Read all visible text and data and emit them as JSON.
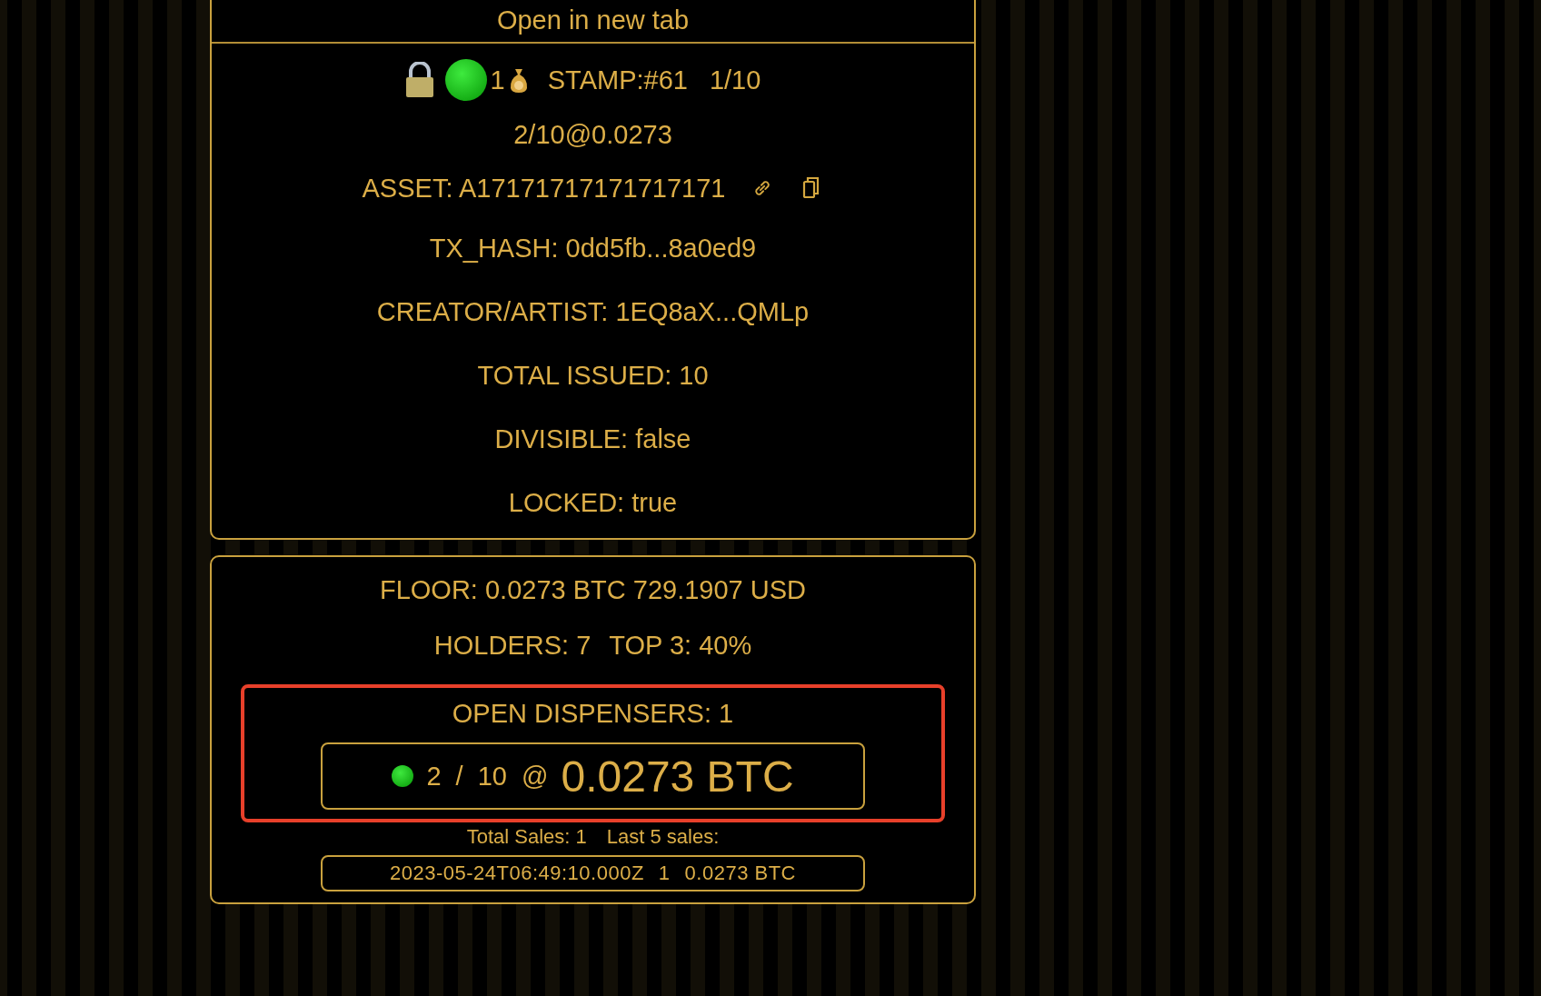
{
  "link": {
    "label": "Open in new tab"
  },
  "header": {
    "count": "1",
    "stamp": "STAMP:#61",
    "edition": "1/10"
  },
  "listing": "2/10@0.0273",
  "asset": {
    "label": "ASSET: A17171717171717171"
  },
  "details": [
    "TX_HASH: 0dd5fb...8a0ed9",
    "CREATOR/ARTIST: 1EQ8aX...QMLp",
    "TOTAL ISSUED: 10",
    "DIVISIBLE: false",
    "LOCKED: true"
  ],
  "market": {
    "floor": "FLOOR: 0.0273 BTC 729.1907 USD",
    "holders": "HOLDERS: 7",
    "top": "TOP 3: 40%"
  },
  "dispensers": {
    "title": "OPEN DISPENSERS: 1",
    "highlighted": true,
    "items": [
      {
        "active": true,
        "quantity": "2 / 10 @",
        "price": "0.0273 BTC"
      }
    ],
    "total_sales": "Total Sales: 1",
    "last_sales": "Last 5 sales:"
  },
  "sales": [
    {
      "time": "2023-05-24T06:49:10.000Z",
      "qty": "1",
      "price": "0.0273 BTC"
    }
  ]
}
